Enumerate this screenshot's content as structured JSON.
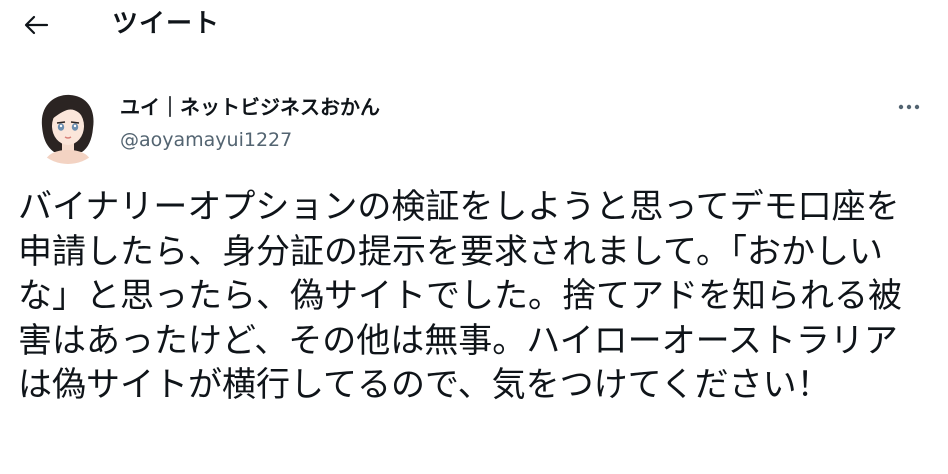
{
  "header": {
    "title": "ツイート"
  },
  "author": {
    "display_name": "ユイ｜ネットビジネスおかん",
    "handle": "@aoyamayui1227"
  },
  "tweet": {
    "text": "バイナリーオプションの検証をしようと思ってデモ口座を申請したら、身分証の提示を要求されまして。「おかしいな」と思ったら、偽サイトでした。捨てアドを知られる被害はあったけど、その他は無事。ハイローオーストラリアは偽サイトが横行してるので、気をつけてください！"
  },
  "icons": {
    "back": "arrow-left-icon",
    "more": "more-horizontal-icon"
  },
  "colors": {
    "text": "#0f1419",
    "secondary": "#536471"
  }
}
